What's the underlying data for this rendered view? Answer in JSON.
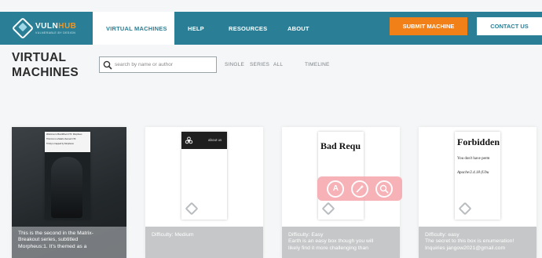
{
  "header": {
    "logo": {
      "name_part1": "VULN",
      "name_part2": "HUB",
      "tagline": "VULNERABLE BY DESIGN"
    },
    "nav": [
      {
        "label": "VIRTUAL MACHINES",
        "active": true
      },
      {
        "label": "HELP"
      },
      {
        "label": "RESOURCES"
      },
      {
        "label": "ABOUT"
      }
    ],
    "submit_label": "SUBMIT MACHINE",
    "contact_label": "CONTACT US"
  },
  "page": {
    "title_line1": "VIRTUAL",
    "title_line2": "MACHINES"
  },
  "search": {
    "placeholder": "search by name or author"
  },
  "filters": {
    "single": "SINGLE",
    "series": "SERIES",
    "all": "ALL",
    "timeline": "TIMELINE"
  },
  "cards": [
    {
      "description_line1": "This is the second in the Matrix-",
      "description_line2": "Breakout series, subtitled",
      "description_line3": "Morpheus:1. It's themed as a",
      "shot_text1": "Welcome to Boot2Root CTF: Morpheus",
      "shot_text2": "This box is a Matrix-themed CTF",
      "shot_text3": "Trinity is trapped by Morpheus"
    },
    {
      "difficulty": "Difficulty: Medium",
      "shot_text": "about us"
    },
    {
      "difficulty": "Difficulty: Easy",
      "description_line1": "Earth is an easy box though you will",
      "description_line2": "likely find it more challenging than",
      "shot_title": "Bad Requ"
    },
    {
      "difficulty": "Difficulty: easy",
      "description_line1": "The secret to this box is enumeration!",
      "description_line2": "Inquiries jangow2021@gmail.com",
      "shot_title": "Forbidden",
      "shot_line1": "You don't have perm",
      "shot_line2": "Apache/2.4.18 (Ubu"
    }
  ],
  "overlay": {
    "btn1": "A"
  },
  "colors": {
    "header": "#2a7f96",
    "accent": "#f28019"
  },
  "icons": [
    "search-icon",
    "vulnhub-logo-icon",
    "biohazard-icon",
    "text-recognition-icon",
    "magic-wand-icon",
    "lens-search-icon"
  ]
}
